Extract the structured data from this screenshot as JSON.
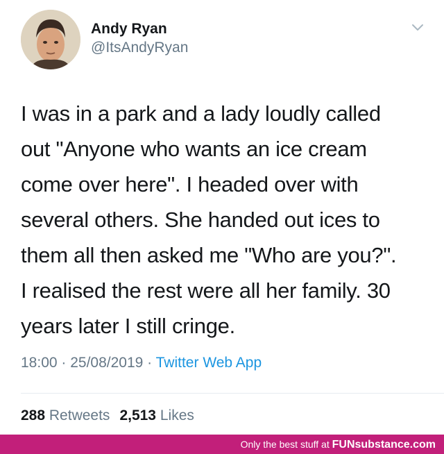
{
  "tweet": {
    "author_name": "Andy Ryan",
    "author_handle": "@ItsAndyRyan",
    "text_lines": [
      "I was in a park and a lady loudly called",
      "out \"Anyone who wants an ice cream",
      "come over here\". I headed over with",
      "several others. She handed out ices to",
      "them all then asked me \"Who are you?\".",
      "I realised the rest were all her family. 30",
      "years later I still cringe."
    ],
    "time": "18:00",
    "separator": " · ",
    "date": "25/08/2019",
    "source": "Twitter Web App",
    "retweets_count": "288",
    "retweets_label": "Retweets",
    "likes_count": "2,513",
    "likes_label": "Likes"
  },
  "footer": {
    "tagline": "Only the best stuff at ",
    "brand": "FUNsubstance.com"
  },
  "colors": {
    "text": "#14171a",
    "secondary": "#657786",
    "link": "#1b95e0",
    "footer_bg": "#c21f7a"
  },
  "icons": {
    "menu": "chevron-down-icon",
    "avatar": "avatar-portrait"
  }
}
